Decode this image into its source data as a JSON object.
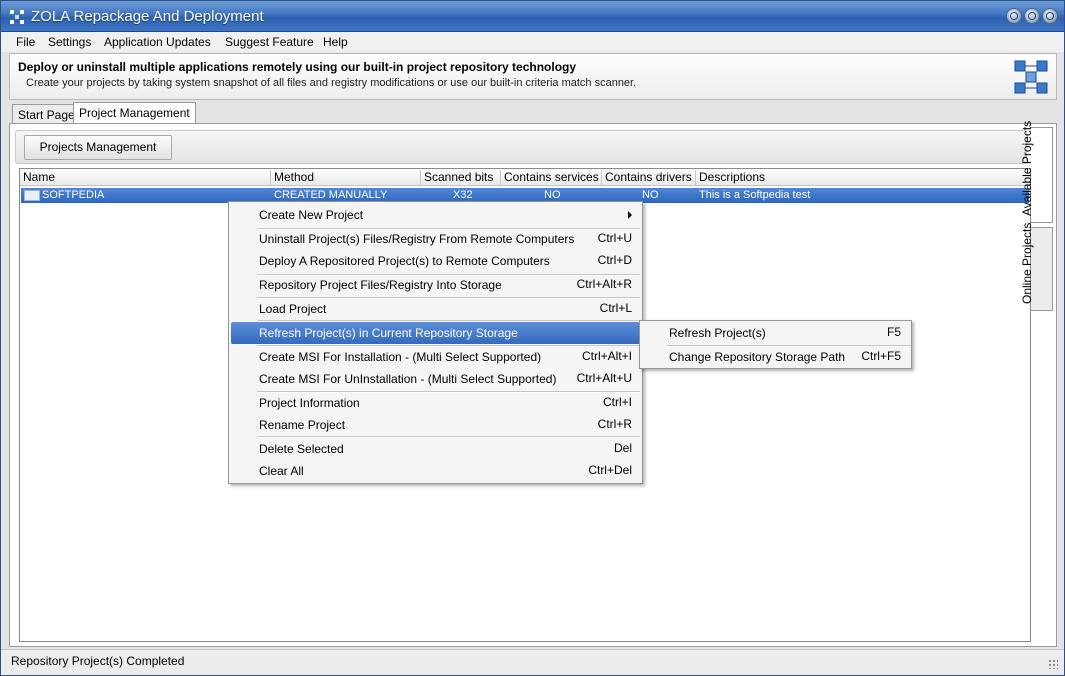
{
  "window": {
    "title": "ZOLA Repackage And Deployment",
    "accent_color": "#3569bd"
  },
  "menubar": {
    "items": [
      {
        "label": "File"
      },
      {
        "label": "Settings"
      },
      {
        "label": "Application Updates"
      },
      {
        "label": "Suggest Feature"
      },
      {
        "label": "Help"
      }
    ]
  },
  "banner": {
    "title": "Deploy or uninstall multiple applications remotely using our built-in project repository technology",
    "subtitle": "Create your projects by taking system snapshot of all files and registry modifications or use our built-in criteria match scanner."
  },
  "tabs": [
    {
      "label": "Start Page",
      "active": false
    },
    {
      "label": "Project Management",
      "active": true
    }
  ],
  "side_tabs": [
    {
      "label": "Available Projects",
      "active": true
    },
    {
      "label": "Online Projects",
      "active": false
    }
  ],
  "toolbar": {
    "projects_management_label": "Projects Management"
  },
  "table": {
    "columns": [
      "Name",
      "Method",
      "Scanned bits",
      "Contains services",
      "Contains drivers",
      "Descriptions"
    ],
    "rows": [
      {
        "name": "SOFTPEDIA",
        "method": "CREATED MANUALLY",
        "bits": "X32",
        "services": "NO",
        "drivers": "NO",
        "description": "This is a Softpedia test",
        "selected": true
      }
    ]
  },
  "context_menu": {
    "items": [
      {
        "label": "Create New Project",
        "shortcut": "",
        "submenu": true
      },
      {
        "label": "Uninstall Project(s) Files/Registry From Remote Computers",
        "shortcut": "Ctrl+U"
      },
      {
        "label": "Deploy A Repositored Project(s) to Remote Computers",
        "shortcut": "Ctrl+D"
      },
      {
        "label": "Repository Project Files/Registry Into Storage",
        "shortcut": "Ctrl+Alt+R"
      },
      {
        "label": "Load Project",
        "shortcut": "Ctrl+L"
      },
      {
        "label": "Refresh Project(s) in Current Repository Storage",
        "shortcut": "",
        "highlighted": true
      },
      {
        "label": "Create MSI For Installation - (Multi Select Supported)",
        "shortcut": "Ctrl+Alt+I"
      },
      {
        "label": "Create MSI For UnInstallation - (Multi Select Supported)",
        "shortcut": "Ctrl+Alt+U"
      },
      {
        "label": "Project Information",
        "shortcut": "Ctrl+I"
      },
      {
        "label": "Rename Project",
        "shortcut": "Ctrl+R"
      },
      {
        "label": "Delete Selected",
        "shortcut": "Del"
      },
      {
        "label": "Clear All",
        "shortcut": "Ctrl+Del"
      }
    ]
  },
  "submenu": {
    "items": [
      {
        "label": "Refresh Project(s)",
        "shortcut": "F5"
      },
      {
        "label": "Change Repository Storage Path",
        "shortcut": "Ctrl+F5"
      }
    ]
  },
  "status": {
    "text": "Repository Project(s) Completed"
  }
}
